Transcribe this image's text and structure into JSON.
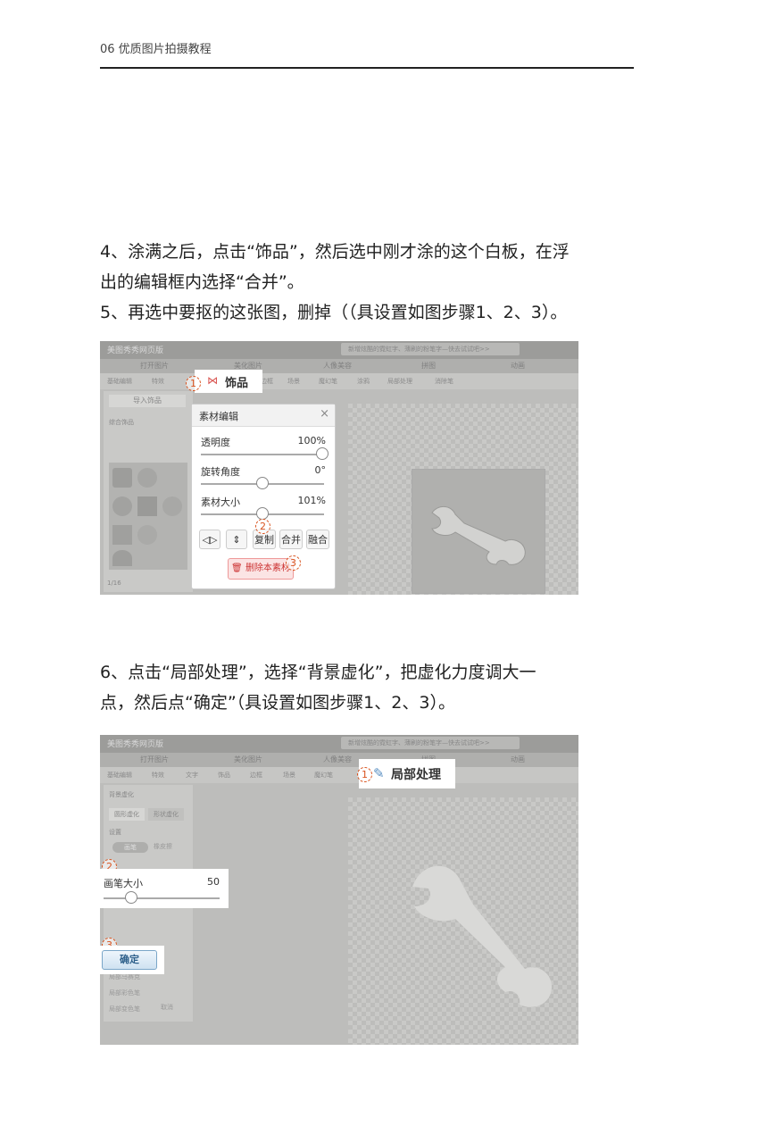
{
  "header": {
    "title": "06 优质图片拍摄教程"
  },
  "step4": {
    "line1": "4、涂满之后，点击“饰品”，然后选中刚才涂的这个白板，在浮",
    "line2": "出的编辑框内选择“合并”。",
    "line3": "5、再选中要抠的这张图，删掉（（具设置如图步骤1、2、3）。"
  },
  "step6": {
    "line1": "6、点击“局部处理”，选择“背景虚化”，把虚化力度调大一",
    "line2": "点，然后点“确定”（具设置如图步骤1、2、3）。"
  },
  "shot1": {
    "app_title": "美图秀秀网页版",
    "ad": "新增炫酷的霓虹字、薄刷的粉笔字—快去试试吧>>",
    "tabs": [
      "打开图片",
      "美化图片",
      "人像美容",
      "拼图",
      "动画"
    ],
    "tools": [
      "基础编辑",
      "特效",
      "边框",
      "场景",
      "魔幻笔",
      "涂鸦",
      "局部处理",
      "消除笔"
    ],
    "side_button": "导入饰品",
    "side_label": "综合饰品",
    "page_info": "1/16",
    "decoration_tab": "饰品",
    "panel": {
      "title": "素材编辑",
      "opacity_label": "透明度",
      "opacity_value": "100%",
      "rotation_label": "旋转角度",
      "rotation_value": "0°",
      "size_label": "素材大小",
      "size_value": "101%",
      "copy_label": "复制",
      "merge_label": "合并",
      "blend_label": "融合",
      "delete_label": "删除本素材"
    },
    "steps": [
      "1",
      "2",
      "3"
    ]
  },
  "shot2": {
    "app_title": "美图秀秀网页版",
    "ad": "新增炫酷的霓虹字、薄刷的粉笔字—快去试试吧>>",
    "tabs": [
      "打开图片",
      "美化图片",
      "人像美容",
      "拼图",
      "动画"
    ],
    "tools": [
      "基础编辑",
      "特效",
      "文字",
      "饰品",
      "边框",
      "场景",
      "魔幻笔"
    ],
    "local_tab": "局部处理",
    "side": {
      "title": "背景虚化",
      "tab1": "圆形虚化",
      "tab2": "形状虚化",
      "setting": "设置",
      "pen": "画笔",
      "eraser": "橡皮擦",
      "items": [
        "局部马赛克",
        "局部彩色笔",
        "局部变色笔"
      ]
    },
    "brush_label": "画笔大小",
    "brush_value": "50",
    "ok_label": "确定",
    "cancel_label": "取消",
    "steps": [
      "1",
      "2",
      "3"
    ]
  }
}
